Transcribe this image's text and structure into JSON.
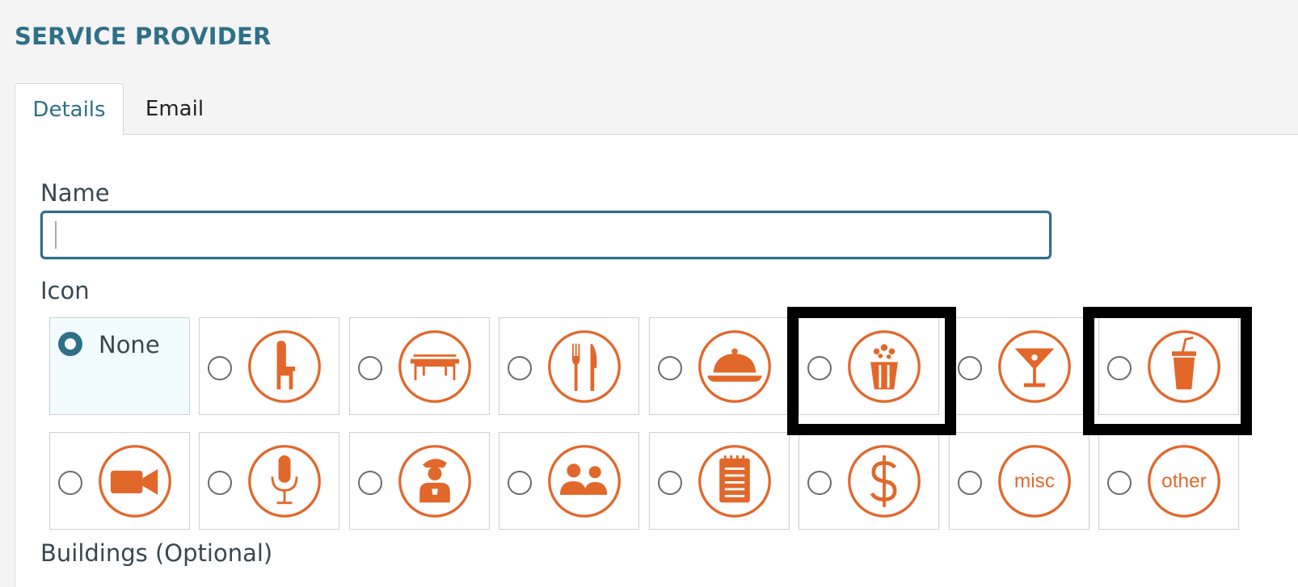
{
  "header": {
    "title": "SERVICE PROVIDER"
  },
  "tabs": [
    {
      "label": "Details",
      "active": true
    },
    {
      "label": "Email",
      "active": false
    }
  ],
  "form": {
    "name_label": "Name",
    "name_value": "",
    "icon_label": "Icon",
    "none_option_label": "None",
    "selected_icon": "None",
    "buildings_label": "Buildings (Optional)"
  },
  "icon_options": [
    {
      "name": "none",
      "label": "None",
      "selected": true
    },
    {
      "name": "chair-icon"
    },
    {
      "name": "table-icon"
    },
    {
      "name": "fork-knife-icon"
    },
    {
      "name": "serving-cloche-icon"
    },
    {
      "name": "popcorn-icon",
      "highlighted": true
    },
    {
      "name": "cocktail-glass-icon"
    },
    {
      "name": "drink-cup-icon",
      "highlighted": true
    },
    {
      "name": "video-camera-icon"
    },
    {
      "name": "microphone-icon"
    },
    {
      "name": "staff-person-icon"
    },
    {
      "name": "people-group-icon"
    },
    {
      "name": "notepad-icon"
    },
    {
      "name": "dollar-icon"
    },
    {
      "name": "misc-icon",
      "text": "misc"
    },
    {
      "name": "other-icon",
      "text": "other"
    }
  ],
  "colors": {
    "accent": "#2f7088",
    "icon_orange": "#e2672a",
    "highlight_border": "#000000"
  }
}
